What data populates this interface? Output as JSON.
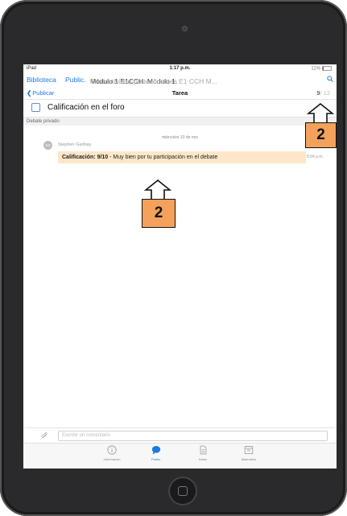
{
  "status_bar": {
    "device": "iPad",
    "time": "1:17 p.m.",
    "battery": "11%"
  },
  "nav": {
    "library": "Biblioteca",
    "public": "Public.",
    "path_main": "Módulo 1 E1CCH: Módulo 1.",
    "path_faded": "Productividad para docentes E1 CCH M..."
  },
  "toolbar": {
    "back_label": "Publicar",
    "title": "Tarea",
    "count_current": "9",
    "count_total": "/ 12"
  },
  "task": {
    "title": "Calificación en el foro"
  },
  "section_label": "Debate privado",
  "message": {
    "date": "miércoles 10 de nov",
    "avatar_initials": "SG",
    "author": "Stephen Garibay",
    "bold_text": "Calificación: 9/10",
    "text": " - Muy bien por tu participación en el debate",
    "time": "8:04 p.m."
  },
  "composer": {
    "placeholder": "Escribir un comentario"
  },
  "tabs": [
    {
      "label": "Información",
      "icon": "info-icon"
    },
    {
      "label": "Public.",
      "icon": "chat-bubble-icon"
    },
    {
      "label": "Notas",
      "icon": "notes-icon"
    },
    {
      "label": "Materiales",
      "icon": "materials-icon"
    }
  ],
  "callouts": [
    {
      "label": "2"
    },
    {
      "label": "2"
    }
  ],
  "colors": {
    "accent": "#1b7ae3",
    "bubble": "#fde6c9",
    "callout": "#f4a15c"
  }
}
